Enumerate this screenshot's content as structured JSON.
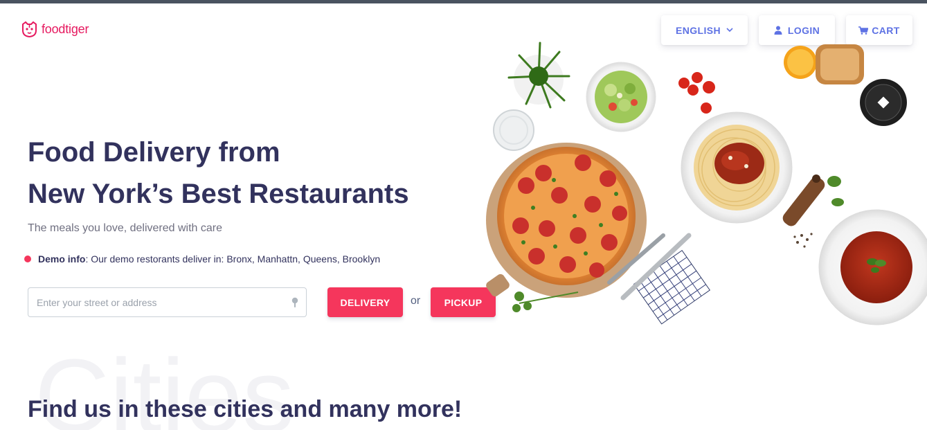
{
  "header": {
    "logo_text": "foodtiger",
    "language_label": "ENGLISH",
    "login_label": "LOGIN",
    "cart_label": "CART"
  },
  "hero": {
    "title_line1": "Food Delivery from",
    "title_bold": "New York’s",
    "title_rest": " Best Restaurants",
    "subtitle": "The meals you love, delivered with care",
    "demo_label": "Demo info",
    "demo_text": ": Our demo restorants deliver in: Bronx, Manhattn, Queens, Brooklyn",
    "address_placeholder": "Enter your street or address",
    "delivery_label": "DELIVERY",
    "or_text": "or",
    "pickup_label": "PICKUP"
  },
  "cities": {
    "background_word": "Cities",
    "title": "Find us in these cities and many more!"
  },
  "icons": {
    "logo": "tiger-icon",
    "language": "chevron-down-icon",
    "login": "user-icon",
    "cart": "cart-icon",
    "address": "map-pin-icon"
  },
  "colors": {
    "brand": "#e6195f",
    "accent": "#f5365c",
    "nav_text": "#5e72e4",
    "heading": "#32325d"
  }
}
